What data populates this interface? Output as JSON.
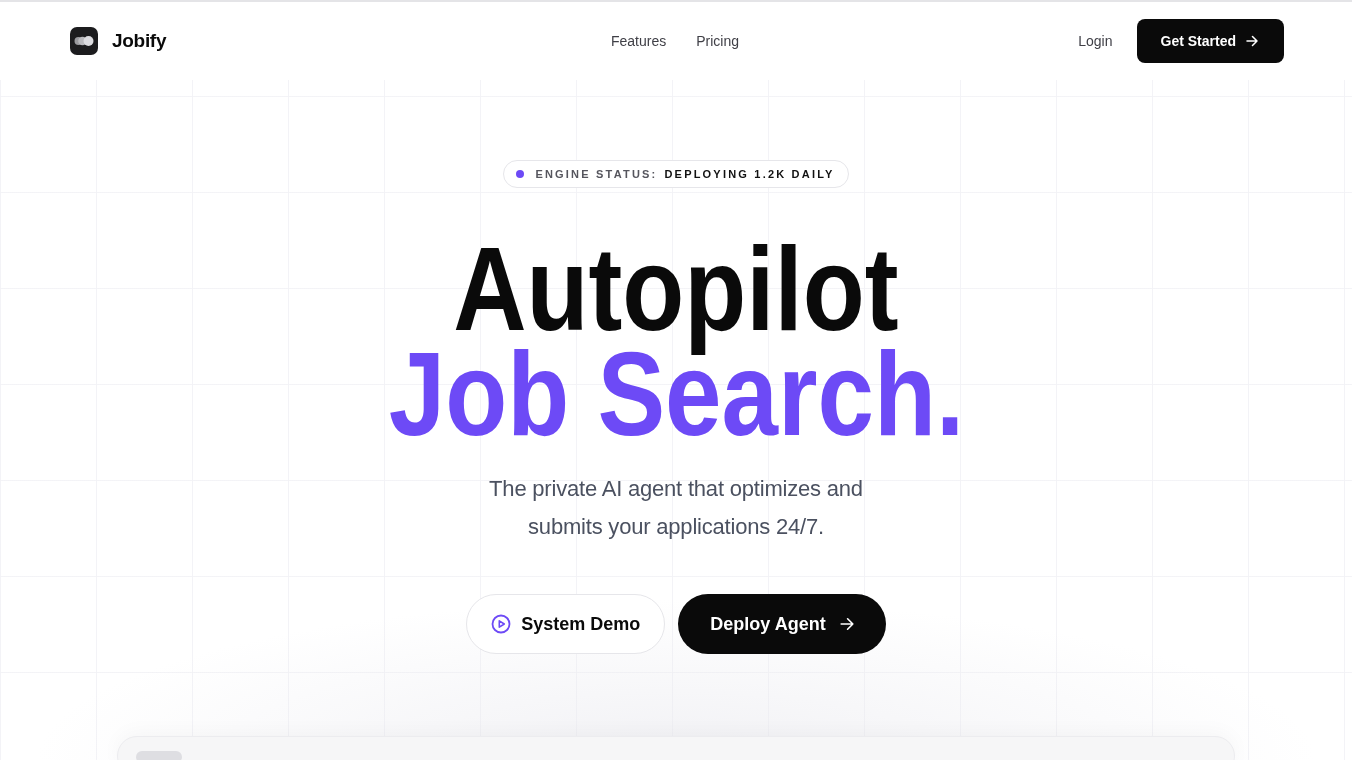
{
  "nav": {
    "brand": "Jobify",
    "links": [
      {
        "label": "Features"
      },
      {
        "label": "Pricing"
      }
    ],
    "login": "Login",
    "cta": "Get Started"
  },
  "badge": {
    "label": "ENGINE STATUS:",
    "value": "DEPLOYING 1.2K DAILY"
  },
  "hero": {
    "title_lines": [
      {
        "text": "Autopilot",
        "kind": "plain"
      },
      {
        "text": "Job Search.",
        "kind": "accent"
      }
    ],
    "subtitle": "The private AI agent that optimizes and submits your applications 24/7."
  },
  "actions": [
    {
      "label": "System Demo",
      "kind": "outline"
    },
    {
      "label": "Deploy Agent",
      "kind": "primary"
    }
  ]
}
